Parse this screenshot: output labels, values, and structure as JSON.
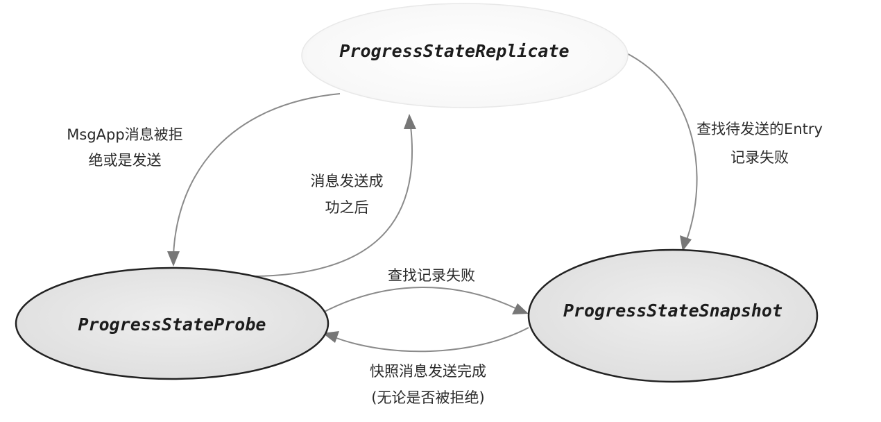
{
  "states": {
    "replicate": "ProgressStateReplicate",
    "probe": "ProgressStateProbe",
    "snapshot": "ProgressStateSnapshot"
  },
  "edges": {
    "replicate_to_probe": [
      "MsgApp消息被拒",
      "绝或是发送"
    ],
    "probe_to_replicate": [
      "消息发送成",
      "功之后"
    ],
    "replicate_to_snapshot": [
      "查找待发送的Entry",
      "记录失败"
    ],
    "probe_to_snapshot": [
      "查找记录失败"
    ],
    "snapshot_to_probe": [
      "快照消息发送完成",
      "(无论是否被拒绝)"
    ]
  },
  "colors": {
    "replicate_fill": "#f7f7f7",
    "probe_fill": "#e6e6e6",
    "snapshot_fill": "#e6e6e6",
    "edge": "#8a8a8a",
    "text": "#1c1c1c"
  }
}
